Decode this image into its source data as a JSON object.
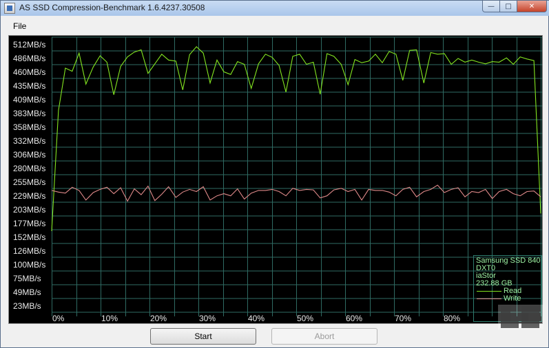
{
  "window": {
    "title": "AS SSD Compression-Benchmark 1.6.4237.30508"
  },
  "menu": {
    "file": "File"
  },
  "buttons": {
    "start": "Start",
    "abort": "Abort"
  },
  "legend": {
    "lines": [
      "Samsung SSD 840",
      "DXT0",
      "iaStor",
      "232.88 GB"
    ],
    "read": "Read",
    "write": "Write"
  },
  "colors": {
    "read": "#84e620",
    "write": "#e08a8a",
    "grid": "#2f6b63",
    "axis_text": "#e8e8e8",
    "background": "#000000"
  },
  "chart_data": {
    "type": "line",
    "title": "",
    "xlabel": "",
    "ylabel": "",
    "y_ticks": [
      "512MB/s",
      "486MB/s",
      "460MB/s",
      "435MB/s",
      "409MB/s",
      "383MB/s",
      "358MB/s",
      "332MB/s",
      "306MB/s",
      "280MB/s",
      "255MB/s",
      "229MB/s",
      "203MB/s",
      "177MB/s",
      "152MB/s",
      "126MB/s",
      "100MB/s",
      "75MB/s",
      "49MB/s",
      "23MB/s"
    ],
    "y_tick_values": [
      512,
      486,
      460,
      435,
      409,
      383,
      358,
      332,
      306,
      280,
      255,
      229,
      203,
      177,
      152,
      126,
      100,
      75,
      49,
      23
    ],
    "x_ticks": [
      "0%",
      "10%",
      "20%",
      "30%",
      "40%",
      "50%",
      "60%",
      "70%",
      "80%"
    ],
    "x_tick_values": [
      0,
      10,
      20,
      30,
      40,
      50,
      60,
      70,
      80
    ],
    "xlim": [
      0,
      100
    ],
    "ylim": [
      0,
      527
    ],
    "grid": true,
    "legend_position": "bottom-right",
    "series": [
      {
        "name": "Read",
        "x": [
          0,
          1.4,
          2.8,
          4.2,
          5.6,
          7.0,
          8.5,
          9.9,
          11.3,
          12.7,
          14.1,
          15.5,
          16.9,
          18.3,
          19.7,
          21.1,
          22.5,
          23.9,
          25.4,
          26.8,
          28.2,
          29.6,
          31.0,
          32.4,
          33.8,
          35.2,
          36.6,
          38.0,
          39.4,
          40.8,
          42.3,
          43.7,
          45.1,
          46.5,
          47.9,
          49.3,
          50.7,
          52.1,
          53.5,
          54.9,
          56.3,
          57.7,
          59.2,
          60.6,
          62.0,
          63.4,
          64.8,
          66.2,
          67.6,
          69.0,
          70.4,
          71.8,
          73.2,
          74.6,
          76.1,
          77.5,
          78.9,
          80.3,
          81.7,
          83.1,
          84.5,
          85.9,
          87.3,
          88.7,
          90.1,
          91.5,
          93.0,
          94.4,
          95.8,
          97.2,
          98.6,
          100
        ],
        "values": [
          162,
          388,
          467,
          461,
          495,
          437,
          469,
          490,
          478,
          417,
          470,
          488,
          497,
          501,
          457,
          475,
          493,
          482,
          480,
          426,
          492,
          507,
          495,
          439,
          482,
          460,
          455,
          479,
          474,
          429,
          475,
          493,
          487,
          472,
          422,
          489,
          493,
          474,
          478,
          418,
          494,
          489,
          474,
          436,
          483,
          477,
          480,
          493,
          477,
          498,
          493,
          444,
          500,
          501,
          439,
          496,
          493,
          494,
          474,
          485,
          478,
          482,
          478,
          475,
          479,
          478,
          486,
          474,
          488,
          484,
          481,
          195
        ],
        "color": "#84e620"
      },
      {
        "name": "Write",
        "x": [
          0,
          1.4,
          2.8,
          4.2,
          5.6,
          7.0,
          8.5,
          9.9,
          11.3,
          12.7,
          14.1,
          15.5,
          16.9,
          18.3,
          19.7,
          21.1,
          22.5,
          23.9,
          25.4,
          26.8,
          28.2,
          29.6,
          31.0,
          32.4,
          33.8,
          35.2,
          36.6,
          38.0,
          39.4,
          40.8,
          42.3,
          43.7,
          45.1,
          46.5,
          47.9,
          49.3,
          50.7,
          52.1,
          53.5,
          54.9,
          56.3,
          57.7,
          59.2,
          60.6,
          62.0,
          63.4,
          64.8,
          66.2,
          67.6,
          69.0,
          70.4,
          71.8,
          73.2,
          74.6,
          76.1,
          77.5,
          78.9,
          80.3,
          81.7,
          83.1,
          84.5,
          85.9,
          87.3,
          88.7,
          90.1,
          91.5,
          93.0,
          94.4,
          95.8,
          97.2,
          98.6,
          100
        ],
        "values": [
          238,
          235,
          233,
          244,
          238,
          220,
          234,
          240,
          244,
          232,
          243,
          218,
          241,
          230,
          246,
          219,
          231,
          245,
          225,
          235,
          240,
          236,
          245,
          220,
          228,
          232,
          228,
          241,
          222,
          233,
          238,
          238,
          240,
          236,
          228,
          242,
          238,
          240,
          239,
          224,
          228,
          239,
          242,
          236,
          240,
          220,
          240,
          238,
          238,
          235,
          228,
          240,
          244,
          226,
          236,
          240,
          248,
          234,
          240,
          243,
          226,
          236,
          234,
          240,
          223,
          236,
          240,
          232,
          228,
          236,
          237,
          226
        ],
        "color": "#e08a8a"
      }
    ]
  }
}
